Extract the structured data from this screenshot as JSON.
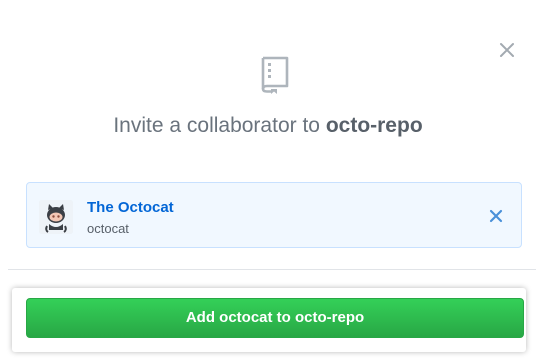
{
  "dialog": {
    "heading_prefix": "Invite a collaborator to",
    "repo_name": "octo-repo",
    "icons": {
      "close": "close-icon",
      "repo": "repo-book-icon",
      "remove": "remove-user-icon",
      "avatar": "octocat-avatar"
    }
  },
  "selected_user": {
    "name": "The Octocat",
    "login": "octocat"
  },
  "footer": {
    "add_button_label": "Add octocat to octo-repo"
  },
  "colors": {
    "link_blue": "#0366d6",
    "card_bg": "#f1f8ff",
    "card_border": "#c8e1ff",
    "button_green": "#28a745",
    "muted_text": "#6a737d"
  }
}
